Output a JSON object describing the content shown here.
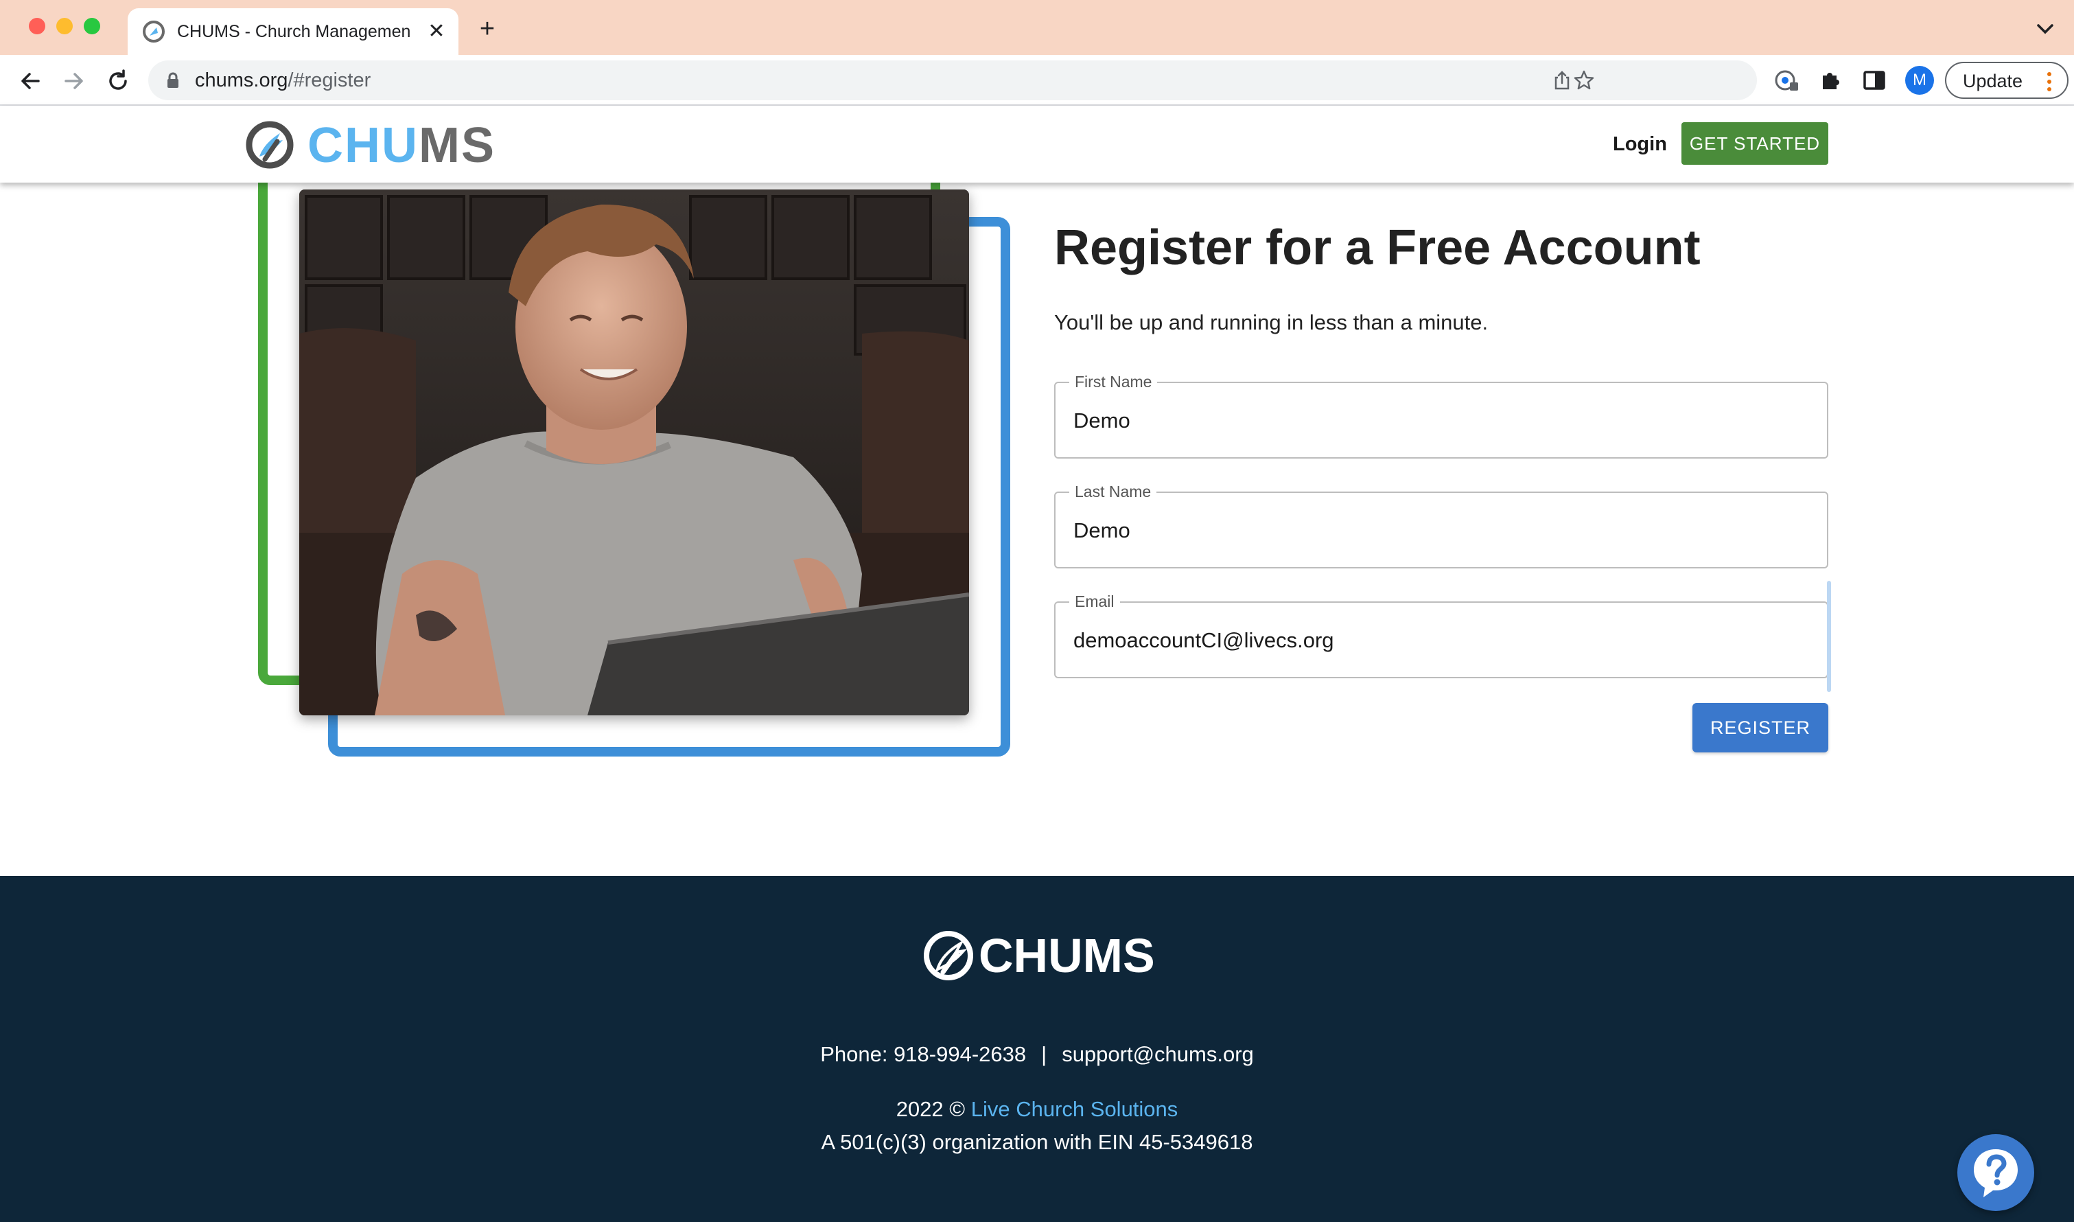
{
  "browser": {
    "tab_title": "CHUMS - Church Management",
    "tab_close": "✕",
    "new_tab": "+",
    "url_domain": "chums.org",
    "url_path": "/#register",
    "profile_initial": "M",
    "update_label": "Update"
  },
  "header": {
    "logo_part1": "CHU",
    "logo_part2": "MS",
    "login_label": "Login",
    "get_started_label": "GET STARTED"
  },
  "form": {
    "title": "Register for a Free Account",
    "subtitle": "You'll be up and running in less than a minute.",
    "fields": [
      {
        "label": "First Name",
        "value": "Demo"
      },
      {
        "label": "Last Name",
        "value": "Demo"
      },
      {
        "label": "Email",
        "value": "demoaccountCI@livecs.org"
      }
    ],
    "register_label": "REGISTER"
  },
  "footer": {
    "logo_text": "CHUMS",
    "phone": "Phone: 918-994-2638",
    "separator": "|",
    "email": "support@chums.org",
    "copyright_prefix": "2022 ©",
    "copyright_link": "Live Church Solutions",
    "ein_line": "A 501(c)(3) organization with EIN 45-5349618"
  },
  "colors": {
    "tabstrip": "#f8d6c4",
    "brand_blue": "#5bb4ef",
    "brand_gray": "#6a6a6a",
    "get_started_green": "#4a8c3a",
    "frame_green": "#4aa83b",
    "frame_blue": "#3d8fd8",
    "register_blue": "#3a78cc",
    "footer_bg": "#0e2639"
  },
  "icons": [
    "back-arrow-icon",
    "forward-arrow-icon",
    "reload-icon",
    "lock-icon",
    "share-icon",
    "star-icon",
    "password-key-icon",
    "puzzle-extension-icon",
    "side-panel-icon",
    "chevron-down-icon",
    "kebab-menu-icon",
    "help-question-icon"
  ]
}
